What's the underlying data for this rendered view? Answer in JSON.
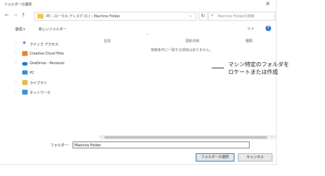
{
  "window": {
    "title": "フォルダーの選択",
    "close": "✕"
  },
  "nav": {
    "back": "←",
    "forward": "→",
    "up": "↑",
    "refresh": "↻"
  },
  "address": {
    "path": "PC  ›  ローカル ディスク (C:)  ›  Machine Folder",
    "drop": "⌄"
  },
  "search": {
    "placeholder": "Machine Folderの検索",
    "icon": "⌕"
  },
  "toolbar": {
    "organize": "整理 ▾",
    "new_folder": "新しいフォルダー",
    "view": "☷ ▾",
    "help": "?"
  },
  "sidebar": {
    "items": [
      {
        "label": "クイック アクセス",
        "icon": "star-icon",
        "color": "#1f6fcf"
      },
      {
        "label": "Creative Cloud Files",
        "icon": "creative-cloud-icon",
        "color": "#e8832a"
      },
      {
        "label": "OneDrive - Personal",
        "icon": "onedrive-icon",
        "color": "#1a73c9"
      },
      {
        "label": "PC",
        "icon": "pc-icon",
        "color": "#2d8fd6"
      },
      {
        "label": "ライブラリ",
        "icon": "library-icon",
        "color": "#e6b84a"
      },
      {
        "label": "ネットワーク",
        "icon": "network-icon",
        "color": "#3b8fd3"
      }
    ]
  },
  "columns": {
    "name": "名前",
    "modified": "更新日時",
    "type": "種類"
  },
  "empty_message": "検索条件に一致する項目はありません。",
  "folder": {
    "label": "フォルダー:",
    "value": "Machine Folder"
  },
  "buttons": {
    "select": "フォルダーの選択",
    "cancel": "キャンセル"
  },
  "annotation": {
    "line1": "マシン特定のフォルダを",
    "line2": "ロケートまたは作成"
  }
}
